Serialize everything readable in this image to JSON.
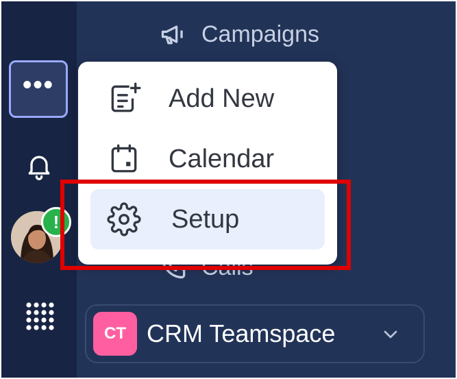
{
  "nav": {
    "items": [
      {
        "label": "Campaigns",
        "icon": "megaphone-icon"
      },
      {
        "label": "Calls",
        "icon": "phone-icon"
      }
    ]
  },
  "rail": {
    "more_label": "•••",
    "alert_badge": "!"
  },
  "menu": {
    "items": [
      {
        "label": "Add New",
        "icon": "add-new-icon"
      },
      {
        "label": "Calendar",
        "icon": "calendar-icon"
      },
      {
        "label": "Setup",
        "icon": "gear-icon",
        "active": true
      }
    ]
  },
  "teamspace": {
    "badge": "CT",
    "name": "CRM Teamspace"
  },
  "colors": {
    "rail_bg": "#182443",
    "nav_bg": "#223358",
    "accent_outline": "#9aa9ff",
    "badge_pink": "#ff5fa0",
    "alert_green": "#27b24a",
    "highlight_red": "#e00000"
  }
}
